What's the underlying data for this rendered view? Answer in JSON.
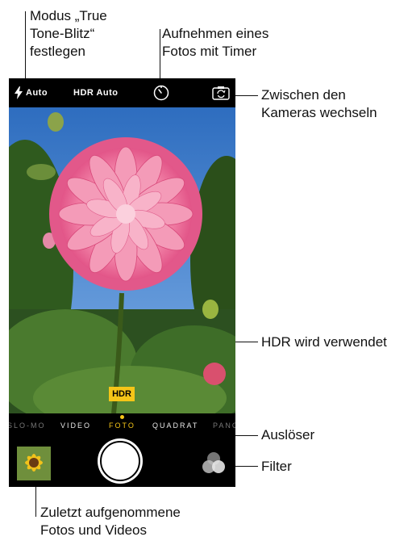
{
  "callouts": {
    "flash_mode": "Modus „True\nTone-Blitz“\nfestlegen",
    "timer": "Aufnehmen eines\nFotos mit Timer",
    "switch_cameras": "Zwischen den\nKameras wechseln",
    "hdr_used": "HDR wird verwendet",
    "shutter": "Auslöser",
    "filter": "Filter",
    "recent": "Zuletzt aufgenommene\nFotos und Videos"
  },
  "topbar": {
    "flash_label": "Auto",
    "hdr_label": "HDR Auto"
  },
  "hdr_badge": "HDR",
  "modes": [
    "SLO-MO",
    "VIDEO",
    "FOTO",
    "QUADRAT",
    "PANO"
  ],
  "selected_mode": "FOTO",
  "colors": {
    "accent": "#f5c518",
    "bar": "#000000",
    "sky": "#3b78c8"
  }
}
